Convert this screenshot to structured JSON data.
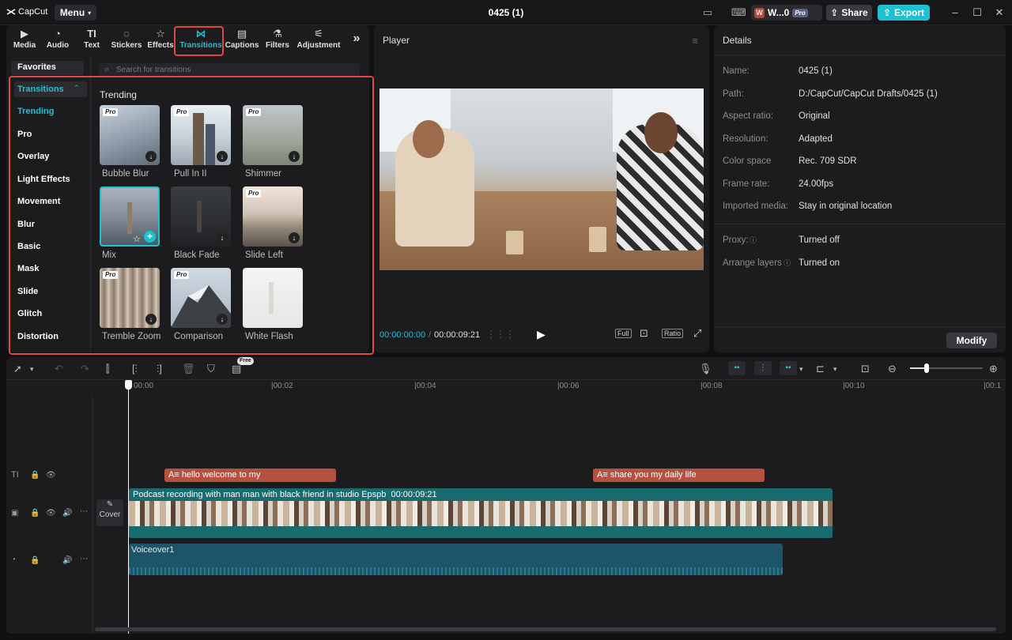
{
  "app": {
    "logo": "CapCut",
    "menu": "Menu",
    "project_title": "0425 (1)"
  },
  "account": {
    "initial": "W",
    "name": "W...0",
    "pro": "Pro"
  },
  "titlebar": {
    "share": "Share",
    "export": "Export"
  },
  "tools": [
    {
      "label": "Media",
      "icon": "media-icon"
    },
    {
      "label": "Audio",
      "icon": "audio-icon"
    },
    {
      "label": "Text",
      "icon": "text-icon"
    },
    {
      "label": "Stickers",
      "icon": "stickers-icon"
    },
    {
      "label": "Effects",
      "icon": "effects-icon"
    },
    {
      "label": "Transitions",
      "icon": "transitions-icon"
    },
    {
      "label": "Captions",
      "icon": "captions-icon"
    },
    {
      "label": "Filters",
      "icon": "filters-icon"
    },
    {
      "label": "Adjustment",
      "icon": "adjustment-icon"
    }
  ],
  "sidebar": {
    "favorites": "Favorites",
    "header": "Transitions",
    "categories": [
      "Trending",
      "Pro",
      "Overlay",
      "Light Effects",
      "Movement",
      "Blur",
      "Basic",
      "Mask",
      "Slide",
      "Glitch",
      "Distortion"
    ]
  },
  "search": {
    "placeholder": "Search for transitions"
  },
  "section_title": "Trending",
  "transitions": [
    {
      "name": "Bubble Blur",
      "pro": true
    },
    {
      "name": "Pull In II",
      "pro": true
    },
    {
      "name": "Shimmer",
      "pro": true
    },
    {
      "name": "Mix",
      "pro": false
    },
    {
      "name": "Black Fade",
      "pro": false
    },
    {
      "name": "Slide Left",
      "pro": true
    },
    {
      "name": "Tremble Zoom",
      "pro": true
    },
    {
      "name": "Comparison",
      "pro": true
    },
    {
      "name": "White Flash",
      "pro": false
    }
  ],
  "pro_label": "Pro",
  "player": {
    "title": "Player",
    "current_time": "00:00:00:00",
    "separator": "/",
    "total_time": "00:00:09:21",
    "full": "Full",
    "ratio": "Ratio"
  },
  "details": {
    "title": "Details",
    "rows": [
      {
        "label": "Name:",
        "value": "0425 (1)"
      },
      {
        "label": "Path:",
        "value": "D:/CapCut/CapCut Drafts/0425 (1)"
      },
      {
        "label": "Aspect ratio:",
        "value": "Original"
      },
      {
        "label": "Resolution:",
        "value": "Adapted"
      },
      {
        "label": "Color space",
        "value": "Rec. 709 SDR"
      },
      {
        "label": "Frame rate:",
        "value": "24.00fps"
      },
      {
        "label": "Imported media:",
        "value": "Stay in original location"
      }
    ],
    "proxy_label": "Proxy:",
    "proxy_value": "Turned off",
    "arrange_label": "Arrange layers",
    "arrange_value": "Turned on",
    "modify": "Modify"
  },
  "timeline": {
    "free_badge": "Free",
    "ruler": [
      "00:00",
      "|00:02",
      "|00:04",
      "|00:06",
      "|00:08",
      "|00:10",
      "|00:1"
    ],
    "text_clips": [
      "hello welcome to my",
      "share you my daily life"
    ],
    "video_clip_title": "Podcast recording with man man with black friend in studio Epspb",
    "video_clip_duration": "00:00:09:21",
    "cover": "Cover",
    "audio_clip": "Voiceover1"
  }
}
